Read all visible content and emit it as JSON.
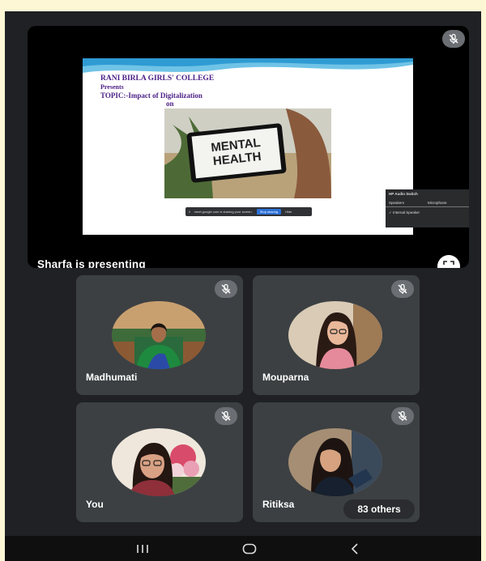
{
  "meeting": {
    "presenter_label": "Sharfa is presenting",
    "others_count_label": "83 others"
  },
  "slide": {
    "college": "RANI BIRLA GIRLS' COLLEGE",
    "presents": "Presents",
    "topic": "TOPIC:-Impact of Digitalization",
    "on": "on",
    "image_text": "MENTAL\nHEALTH"
  },
  "share_bar": {
    "message": "meet.google.com is sharing your screen.",
    "stop_label": "Stop sharing",
    "hide_label": "Hide"
  },
  "audio_popup": {
    "title": "HP Audio Switch",
    "speakers_label": "Speakers",
    "microphone_label": "Microphone",
    "selected_device": "✓  Internal Speaker"
  },
  "participants": [
    {
      "name": "Madhumati",
      "muted": true
    },
    {
      "name": "Mouparna",
      "muted": true
    },
    {
      "name": "You",
      "muted": true
    },
    {
      "name": "Ritiksa",
      "muted": true
    }
  ],
  "icons": {
    "mute": "mic-off-icon",
    "fullscreen": "fullscreen-icon",
    "nav_recents": "recents-icon",
    "nav_home": "home-icon",
    "nav_back": "back-icon"
  },
  "colors": {
    "background": "#1f2124",
    "tile": "#3c4043",
    "mute_badge": "#6b6e72",
    "slide_text": "#4a1e86",
    "stop_sharing": "#2b6fd6"
  }
}
